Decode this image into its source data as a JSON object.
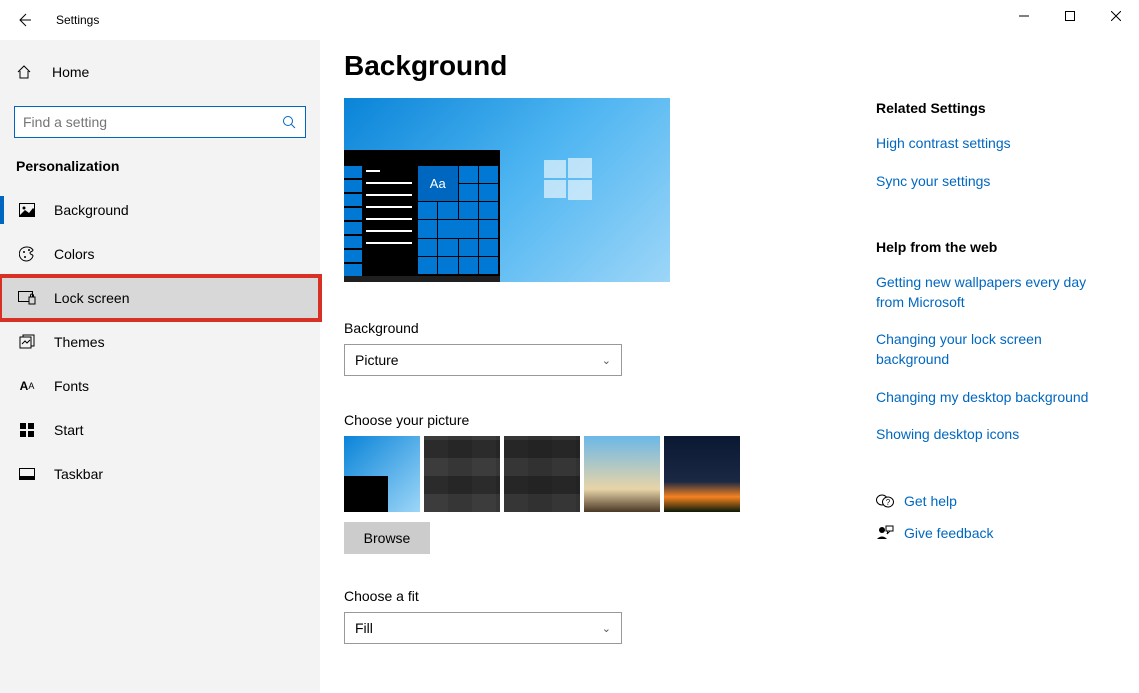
{
  "titlebar": {
    "title": "Settings"
  },
  "sidebar": {
    "home_label": "Home",
    "search_placeholder": "Find a setting",
    "section_label": "Personalization",
    "nav": [
      {
        "icon": "picture-icon",
        "label": "Background"
      },
      {
        "icon": "palette-icon",
        "label": "Colors"
      },
      {
        "icon": "lock-screen-icon",
        "label": "Lock screen"
      },
      {
        "icon": "themes-icon",
        "label": "Themes"
      },
      {
        "icon": "fonts-icon",
        "label": "Fonts"
      },
      {
        "icon": "start-icon",
        "label": "Start"
      },
      {
        "icon": "taskbar-icon",
        "label": "Taskbar"
      }
    ]
  },
  "main": {
    "page_title": "Background",
    "preview_sample_text": "Aa",
    "bg_label": "Background",
    "bg_value": "Picture",
    "choose_picture_label": "Choose your picture",
    "browse_label": "Browse",
    "fit_label": "Choose a fit",
    "fit_value": "Fill"
  },
  "right": {
    "related_heading": "Related Settings",
    "related_links": [
      "High contrast settings",
      "Sync your settings"
    ],
    "help_heading": "Help from the web",
    "help_links": [
      "Getting new wallpapers every day from Microsoft",
      "Changing your lock screen background",
      "Changing my desktop background",
      "Showing desktop icons"
    ],
    "get_help_label": "Get help",
    "feedback_label": "Give feedback"
  }
}
